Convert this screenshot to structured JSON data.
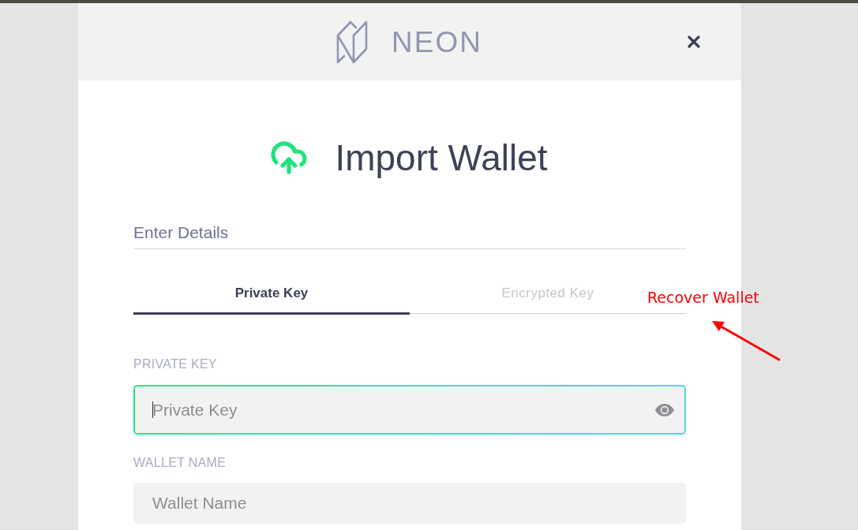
{
  "header": {
    "brand": "NEON"
  },
  "title": "Import Wallet",
  "section_title": "Enter Details",
  "tabs": [
    {
      "label": "Private Key",
      "selected": true
    },
    {
      "label": "Encrypted Key",
      "selected": false
    }
  ],
  "fields": [
    {
      "label": "PRIVATE KEY",
      "placeholder": "Private Key",
      "focused": true,
      "kind": "secret"
    },
    {
      "label": "WALLET NAME",
      "placeholder": "Wallet Name",
      "focused": false,
      "kind": "text"
    }
  ],
  "annotation": {
    "text": "Recover Wallet",
    "color": "#ff0000"
  }
}
